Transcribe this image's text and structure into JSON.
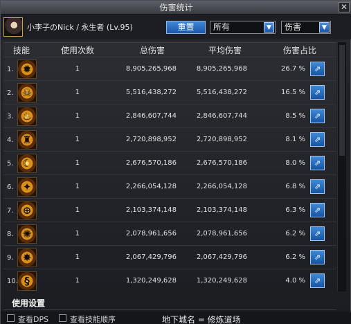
{
  "window": {
    "title": "伤害统计",
    "close_glyph": "✕"
  },
  "toolbar": {
    "player_label": "小李子のNick / 永生者 (Lv.95)",
    "reset_label": "重置",
    "target_select": "所有",
    "metric_select": "伤害"
  },
  "table": {
    "headers": {
      "skill": "技能",
      "uses": "使用次数",
      "total": "总伤害",
      "avg": "平均伤害",
      "share": "伤害占比"
    },
    "rows": [
      {
        "idx": "1.",
        "uses": "1",
        "total": "8,905,265,968",
        "avg": "8,905,265,968",
        "pct": "26.7 %",
        "icon": "skill-icon-1"
      },
      {
        "idx": "2.",
        "uses": "1",
        "total": "5,516,438,272",
        "avg": "5,516,438,272",
        "pct": "16.5 %",
        "icon": "skill-icon-2"
      },
      {
        "idx": "3.",
        "uses": "1",
        "total": "2,846,607,744",
        "avg": "2,846,607,744",
        "pct": "8.5 %",
        "icon": "skill-icon-3"
      },
      {
        "idx": "4.",
        "uses": "1",
        "total": "2,720,898,952",
        "avg": "2,720,898,952",
        "pct": "8.1 %",
        "icon": "skill-icon-4"
      },
      {
        "idx": "5.",
        "uses": "1",
        "total": "2,676,570,186",
        "avg": "2,676,570,186",
        "pct": "8.0 %",
        "icon": "skill-icon-5"
      },
      {
        "idx": "6.",
        "uses": "1",
        "total": "2,266,054,128",
        "avg": "2,266,054,128",
        "pct": "6.8 %",
        "icon": "skill-icon-6"
      },
      {
        "idx": "7.",
        "uses": "1",
        "total": "2,103,374,148",
        "avg": "2,103,374,148",
        "pct": "6.3 %",
        "icon": "skill-icon-7"
      },
      {
        "idx": "8.",
        "uses": "1",
        "total": "2,078,961,656",
        "avg": "2,078,961,656",
        "pct": "6.2 %",
        "icon": "skill-icon-8"
      },
      {
        "idx": "9.",
        "uses": "1",
        "total": "2,067,429,796",
        "avg": "2,067,429,796",
        "pct": "6.2 %",
        "icon": "skill-icon-9"
      },
      {
        "idx": "10.",
        "uses": "1",
        "total": "1,320,249,628",
        "avg": "1,320,249,628",
        "pct": "4.0 %",
        "icon": "skill-icon-10"
      }
    ]
  },
  "usage_settings": "使用设置",
  "footer": {
    "view_dps": "查看DPS",
    "view_skill_order": "查看技能顺序",
    "dungeon": "地下城名 = 修炼道场"
  },
  "colors": {
    "accent_blue": "#2a6fc4",
    "gold_icon": "#d8911c"
  }
}
